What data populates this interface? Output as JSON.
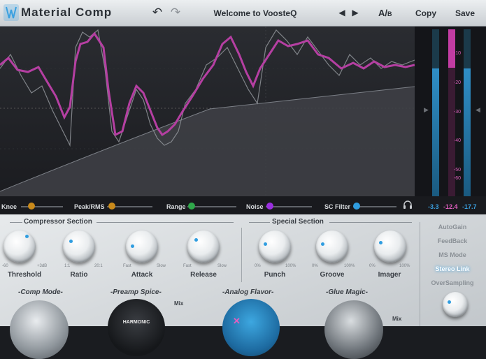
{
  "header": {
    "product": "Material Comp",
    "preset_name": "Welcome to VoosteQ",
    "ab_main": "A/",
    "ab_sub": "B",
    "copy": "Copy",
    "save": "Save"
  },
  "meters": {
    "scale": [
      "-10",
      "-20",
      "-30",
      "-40",
      "-50",
      "-60"
    ],
    "values": [
      "-3.3",
      "-12.4",
      "-17.7"
    ],
    "colors": [
      "#3aa0e0",
      "#e05fbf",
      "#3aa0e0"
    ]
  },
  "params": [
    {
      "label": "Knee",
      "color": "#c98a1a"
    },
    {
      "label": "Peak/RMS",
      "color": "#c98a1a"
    },
    {
      "label": "Range",
      "color": "#2fa84a"
    },
    {
      "label": "Noise",
      "color": "#9a2ee0"
    },
    {
      "label": "SC Filter",
      "color": "#2f9de0"
    }
  ],
  "compressor": {
    "title": "Compressor Section",
    "knobs": [
      {
        "label": "Threshold",
        "min": "-60",
        "max": "+3dB"
      },
      {
        "label": "Ratio",
        "min": "1:1",
        "max": "20:1"
      },
      {
        "label": "Attack",
        "min": "Fast",
        "max": "Slow"
      },
      {
        "label": "Release",
        "min": "Fast",
        "max": "Slow"
      }
    ]
  },
  "special": {
    "title": "Special Section",
    "knobs": [
      {
        "label": "Punch",
        "min": "0%",
        "max": "100%"
      },
      {
        "label": "Groove",
        "min": "0%",
        "max": "100%"
      },
      {
        "label": "Imager",
        "min": "0%",
        "max": "100%"
      }
    ]
  },
  "side_options": [
    "AutoGain",
    "FeedBack",
    "MS Mode",
    "Stereo Link",
    "OverSampling"
  ],
  "groups": [
    {
      "title": "-Comp Mode-"
    },
    {
      "title": "-Preamp Spice-",
      "mix": "Mix",
      "emblem": "HARMONIC"
    },
    {
      "title": "-Analog Flavor-"
    },
    {
      "title": "-Glue Magic-",
      "mix": "Mix"
    }
  ],
  "colors": {
    "accent": "#2f9de0",
    "magenta": "#e05fbf",
    "graph_bg": "#1c1d21"
  }
}
